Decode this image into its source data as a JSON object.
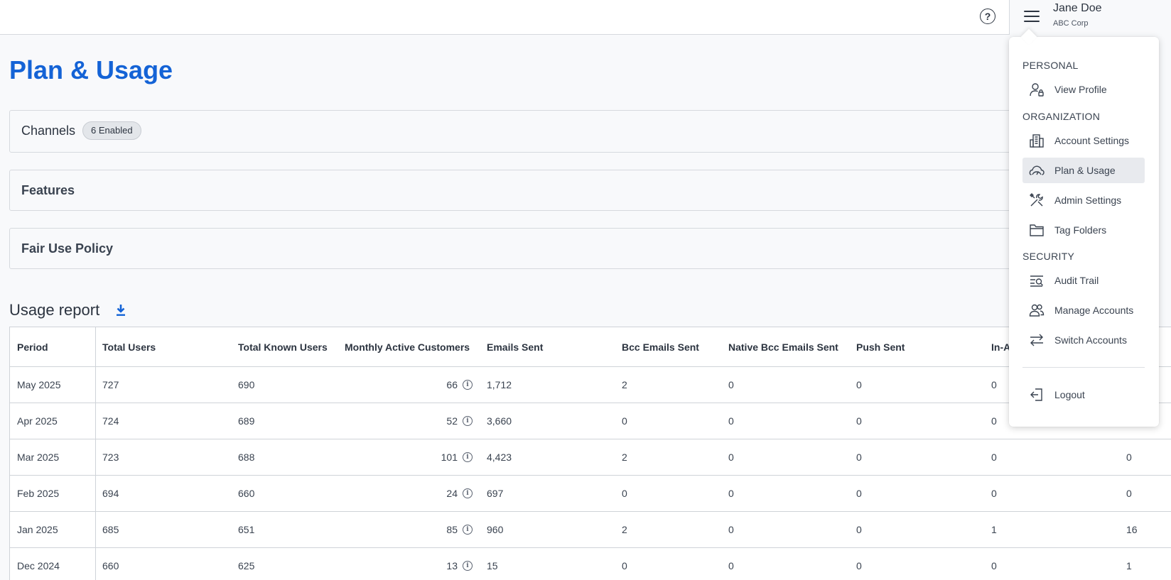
{
  "topbar": {
    "help_icon": "question-circle-icon",
    "menu_icon": "hamburger-icon",
    "user_name": "Jane Doe",
    "user_org": "ABC Corp"
  },
  "page": {
    "title": "Plan & Usage",
    "panels": {
      "channels": {
        "title": "Channels",
        "badge": "6 Enabled"
      },
      "features": {
        "title": "Features"
      },
      "fair_use": {
        "title": "Fair Use Policy"
      }
    },
    "usage_report_title": "Usage report"
  },
  "table": {
    "columns": [
      "Period",
      "Total Users",
      "Total Known Users",
      "Monthly Active Customers",
      "Emails Sent",
      "Bcc Emails Sent",
      "Native Bcc Emails Sent",
      "Push Sent",
      "In-A",
      ""
    ],
    "rows": [
      {
        "period": "May 2025",
        "total_users": "727",
        "known_users": "690",
        "mac": "66",
        "emails": "1,712",
        "bcc": "2",
        "native_bcc": "0",
        "push": "0",
        "in_app": "0",
        "last": ""
      },
      {
        "period": "Apr 2025",
        "total_users": "724",
        "known_users": "689",
        "mac": "52",
        "emails": "3,660",
        "bcc": "0",
        "native_bcc": "0",
        "push": "0",
        "in_app": "0",
        "last": ""
      },
      {
        "period": "Mar 2025",
        "total_users": "723",
        "known_users": "688",
        "mac": "101",
        "emails": "4,423",
        "bcc": "2",
        "native_bcc": "0",
        "push": "0",
        "in_app": "0",
        "last": "0"
      },
      {
        "period": "Feb 2025",
        "total_users": "694",
        "known_users": "660",
        "mac": "24",
        "emails": "697",
        "bcc": "0",
        "native_bcc": "0",
        "push": "0",
        "in_app": "0",
        "last": "0"
      },
      {
        "period": "Jan 2025",
        "total_users": "685",
        "known_users": "651",
        "mac": "85",
        "emails": "960",
        "bcc": "2",
        "native_bcc": "0",
        "push": "0",
        "in_app": "1",
        "last": "16"
      },
      {
        "period": "Dec 2024",
        "total_users": "660",
        "known_users": "625",
        "mac": "13",
        "emails": "15",
        "bcc": "0",
        "native_bcc": "0",
        "push": "0",
        "in_app": "0",
        "last": "1"
      }
    ]
  },
  "dropdown": {
    "sections": {
      "personal": "PERSONAL",
      "organization": "ORGANIZATION",
      "security": "SECURITY"
    },
    "items": {
      "view_profile": "View Profile",
      "account_settings": "Account Settings",
      "plan_usage": "Plan & Usage",
      "admin_settings": "Admin Settings",
      "tag_folders": "Tag Folders",
      "audit_trail": "Audit Trail",
      "manage_accounts": "Manage Accounts",
      "switch_accounts": "Switch Accounts",
      "logout": "Logout"
    },
    "active_item": "Plan & Usage"
  },
  "colors": {
    "accent": "#1463d6",
    "text": "#2c3440",
    "border": "#d6d9de",
    "active_bg": "#e8eaee"
  }
}
